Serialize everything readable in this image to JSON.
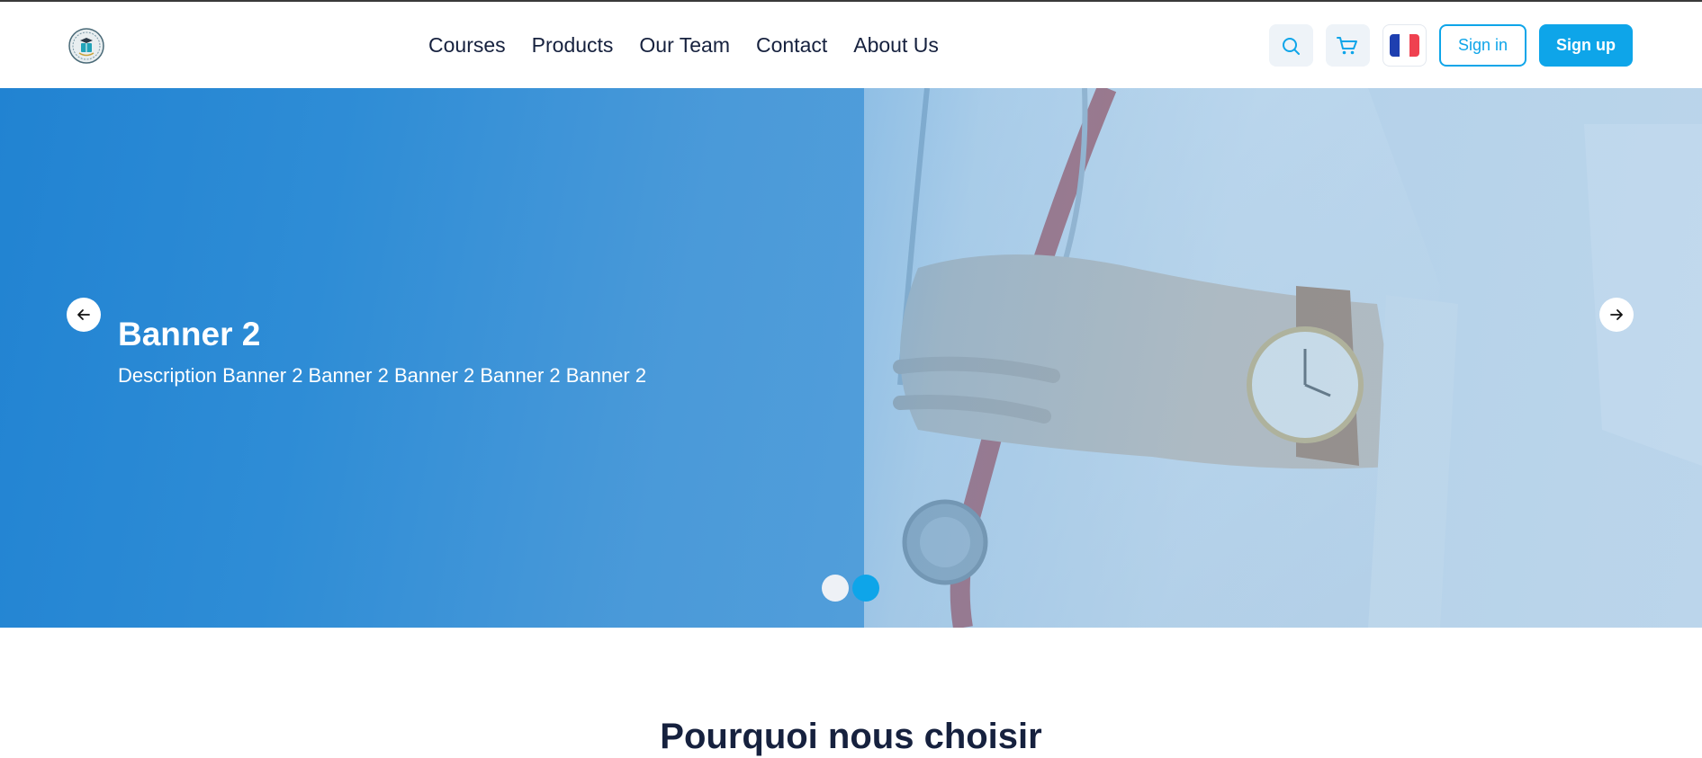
{
  "colors": {
    "accent": "#0ea5e9",
    "hero_blue": "#2587d4",
    "nav_text": "#16213e",
    "dot_inactive": "#eef1f6",
    "dot_active": "#0ea5e9",
    "flag_blue": "#1e3fb0",
    "flag_white": "#ffffff",
    "flag_red": "#ef4150"
  },
  "header": {
    "logo_icon": "school-emblem-icon",
    "nav": [
      {
        "label": "Courses"
      },
      {
        "label": "Products"
      },
      {
        "label": "Our Team"
      },
      {
        "label": "Contact"
      },
      {
        "label": "About Us"
      }
    ],
    "actions": {
      "search_icon": "search-icon",
      "cart_icon": "cart-icon",
      "language_icon": "france-flag-icon",
      "sign_in": "Sign in",
      "sign_up": "Sign up"
    }
  },
  "hero": {
    "title": "Banner 2",
    "description": "Description Banner 2 Banner 2 Banner 2 Banner 2 Banner 2",
    "prev_icon": "arrow-left-icon",
    "next_icon": "arrow-right-icon",
    "slide_count": 2,
    "active_slide": 2
  },
  "section": {
    "title": "Pourquoi nous choisir"
  }
}
